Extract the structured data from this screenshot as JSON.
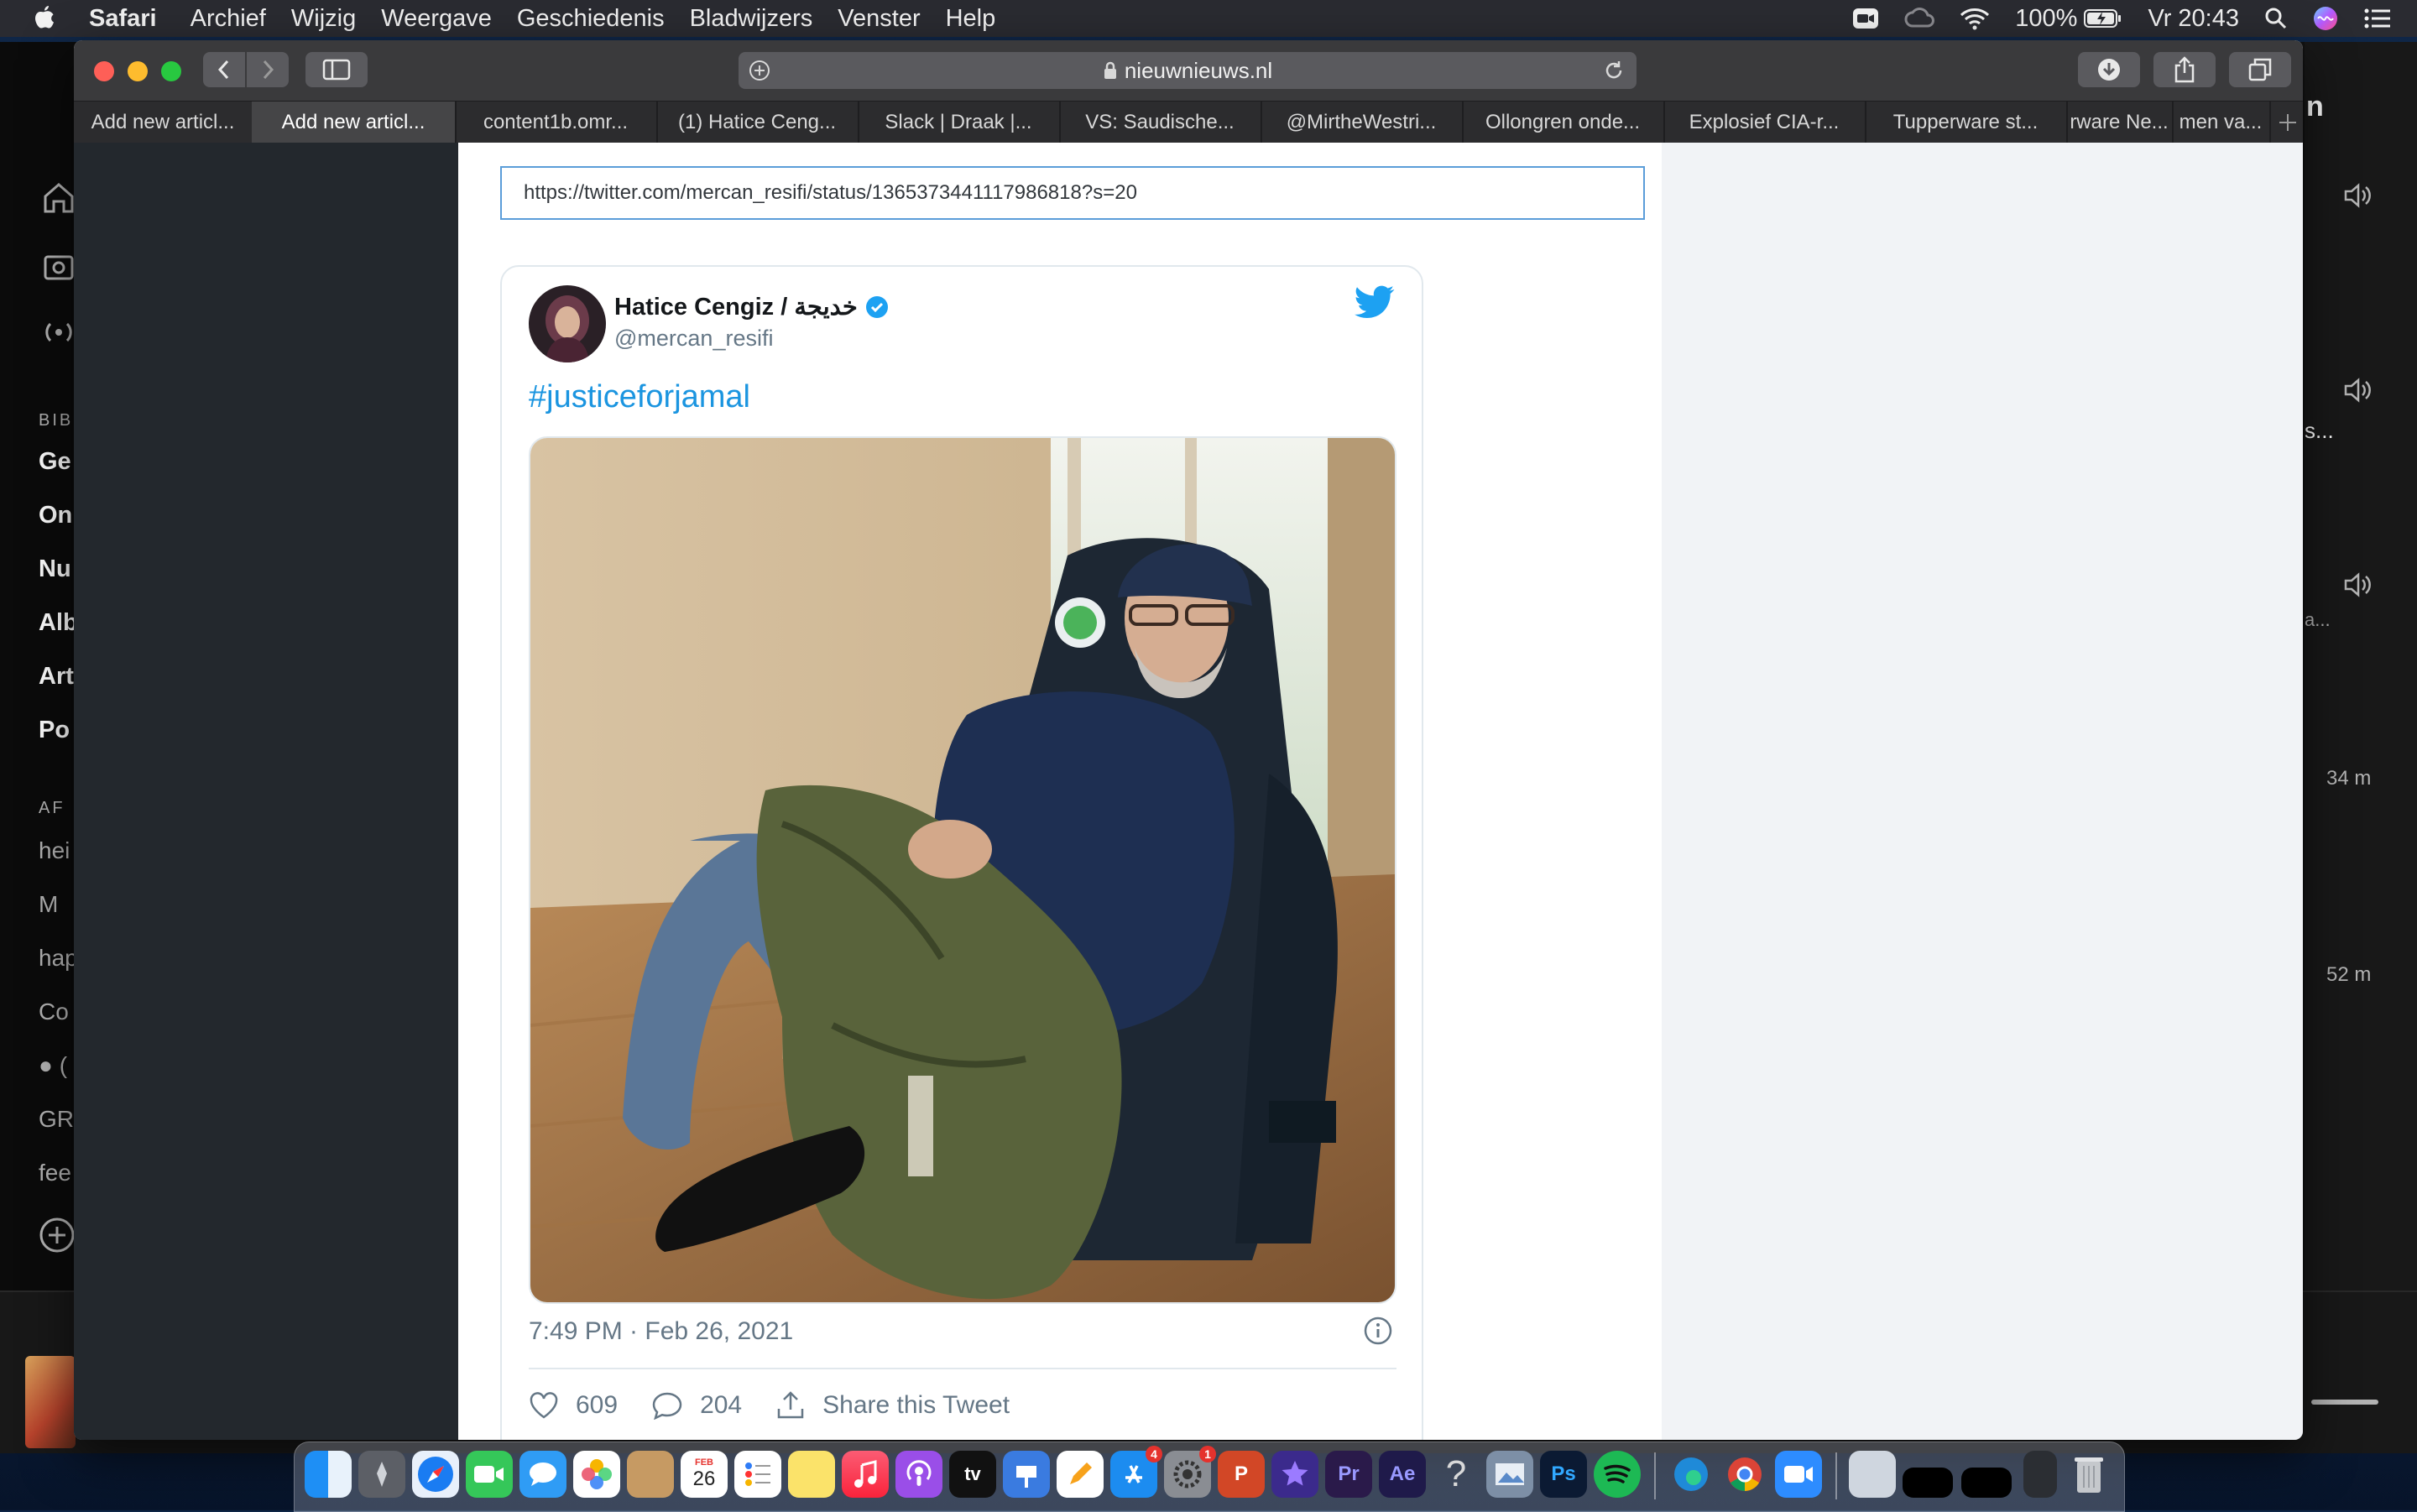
{
  "menubar": {
    "app_name": "Safari",
    "items": [
      "Archief",
      "Wijzig",
      "Weergave",
      "Geschiedenis",
      "Bladwijzers",
      "Venster",
      "Help"
    ],
    "battery": "100%",
    "clock": "Vr 20:43"
  },
  "spotify": {
    "section_library": "BIB",
    "library_items": [
      "Ge",
      "On",
      "Nu",
      "Alb",
      "Art",
      "Po"
    ],
    "section_playlists": "AF",
    "playlists": [
      "hei",
      "M",
      "hap",
      "Co",
      "● (",
      "GR",
      "fee"
    ],
    "right_letter": "n",
    "right_snippets": [
      "s...",
      "a..."
    ],
    "durations": [
      "34 m",
      "52 m"
    ]
  },
  "safari": {
    "url": "nieuwnieuws.nl",
    "tabs": [
      "Add new articl...",
      "Add new articl...",
      "content1b.omr...",
      "(1) Hatice Ceng...",
      "Slack | Draak |...",
      "VS: Saudische...",
      "@MirtheWestri...",
      "Ollongren onde...",
      "Explosief CIA-r...",
      "Tupperware st...",
      "rware Ne...",
      "men va..."
    ],
    "active_tab_index": 1
  },
  "editor": {
    "embed_url": "https://twitter.com/mercan_resifi/status/1365373441117986818?s=20"
  },
  "tweet": {
    "display_name": "Hatice Cengiz / خديجة",
    "handle": "@mercan_resifi",
    "text": "#justiceforjamal",
    "timestamp": "7:49 PM · Feb 26, 2021",
    "likes": "609",
    "replies": "204",
    "share_label": "Share this Tweet",
    "accent_color": "#1b95e0"
  },
  "dock": {
    "calendar_month": "FEB",
    "calendar_day": "26",
    "appstore_badge": "4",
    "settings_badge": "1",
    "premiere_label": "Pr",
    "aftereffects_label": "Ae",
    "photoshop_label": "Ps",
    "powerpoint_label": "P",
    "help_label": "?",
    "appletv_label": "tv"
  }
}
